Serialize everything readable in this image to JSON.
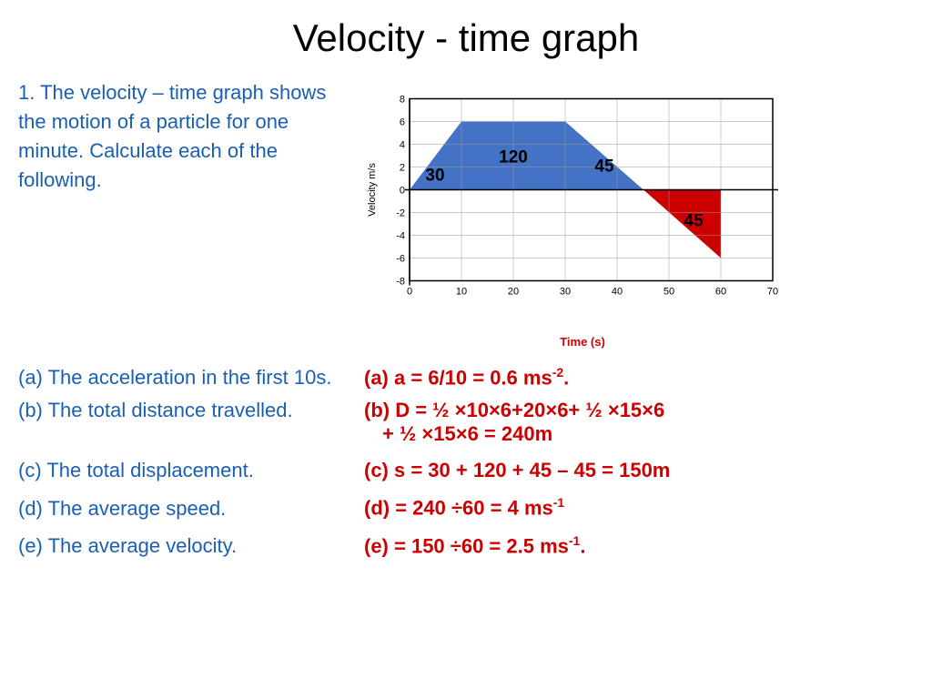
{
  "title": "Velocity -  time graph",
  "description": "1. The velocity – time graph shows the motion of a particle for one minute. Calculate each of the following.",
  "graph": {
    "x_label": "Time (s)",
    "y_label": "Velocity m/s",
    "area_labels": [
      "30",
      "120",
      "45"
    ],
    "red_area_label": "45"
  },
  "qa": [
    {
      "question": "(a) The acceleration in the first 10s.",
      "answer": "(a)  a = 6/10 = 0.6 ms",
      "answer_sup": "-2",
      "answer_suffix": "."
    },
    {
      "question": "(b) The total distance travelled.",
      "answer": "(b) D = ½ ×10×6+20×6+ ½ ×15×6",
      "answer2": "+ ½ ×15×6 = 240m"
    },
    {
      "question": "(c) The total displacement.",
      "answer": "(c) s = 30 + 120 + 45 – 45 = 150m"
    },
    {
      "question": "(d) The average speed.",
      "answer": "(d)  = 240 ÷60 = 4 ms",
      "answer_sup": "-1"
    },
    {
      "question": "(e) The average velocity.",
      "answer": "(e)  = 150 ÷60 = 2.5 ms",
      "answer_sup": "-1",
      "answer_suffix": "."
    }
  ]
}
